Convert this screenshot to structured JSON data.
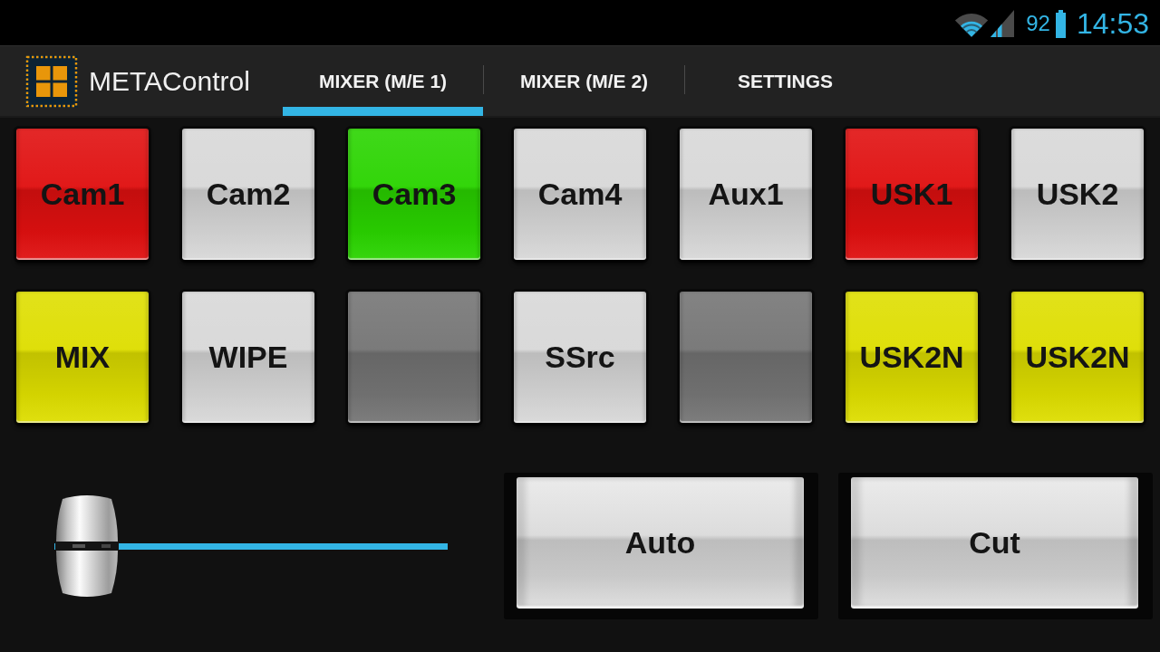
{
  "status_bar": {
    "battery_percent": "92",
    "time": "14:53"
  },
  "action_bar": {
    "app_title": "METAControl",
    "tabs": [
      {
        "label": "MIXER (M/E 1)",
        "selected": true
      },
      {
        "label": "MIXER (M/E 2)",
        "selected": false
      },
      {
        "label": "SETTINGS",
        "selected": false
      }
    ]
  },
  "button_rows": [
    [
      {
        "label": "Cam1",
        "color": "#e01010"
      },
      {
        "label": "Cam2",
        "color": "#d8d8d8"
      },
      {
        "label": "Cam3",
        "color": "#2ad400"
      },
      {
        "label": "Cam4",
        "color": "#d8d8d8"
      },
      {
        "label": "Aux1",
        "color": "#d8d8d8"
      },
      {
        "label": "USK1",
        "color": "#e01010"
      },
      {
        "label": "USK2",
        "color": "#d8d8d8"
      }
    ],
    [
      {
        "label": "MIX",
        "color": "#dede00"
      },
      {
        "label": "WIPE",
        "color": "#d8d8d8"
      },
      {
        "color": "#757575"
      },
      {
        "label": "SSrc",
        "color": "#d8d8d8"
      },
      {
        "color": "#757575"
      },
      {
        "label": "USK2N",
        "color": "#dede00"
      },
      {
        "label": "USK2N",
        "color": "#dede00"
      }
    ]
  ],
  "fader": {
    "level": 0
  },
  "transition_buttons": [
    {
      "label": "Auto"
    },
    {
      "label": "Cut"
    }
  ]
}
